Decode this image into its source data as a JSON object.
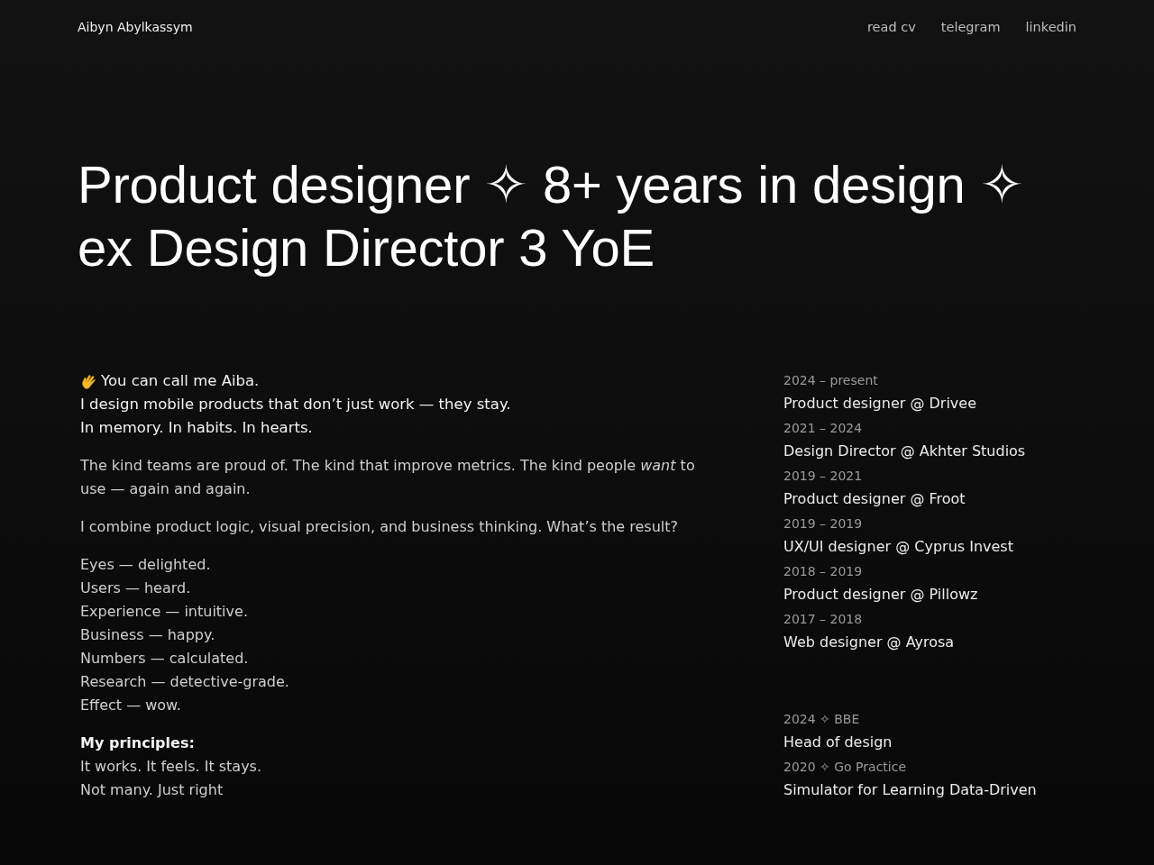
{
  "header": {
    "name": "Aibyn Abylkassym",
    "links": [
      "read cv",
      "telegram",
      "linkedin"
    ]
  },
  "headline": [
    "Product designer ✧ 8+ years in design ✧",
    "ex Design Director 3 YoE"
  ],
  "intro": [
    "You can call me Aiba.",
    "I design mobile products that don’t just work — they stay.",
    "In memory. In habits. In hearts."
  ],
  "paragraphs": [
    "The kind teams are proud of. The kind that improve metrics. The kind people *want* to use — again and again.",
    "I combine product logic, visual precision, and business thinking. What’s the result?"
  ],
  "results": [
    "Eyes — delighted.",
    "Users — heard.",
    "Experience — intuitive.",
    "Business — happy.",
    "Numbers — calculated.",
    "Research — detective-grade.",
    "Effect — wow."
  ],
  "principles": {
    "title": "My principles:",
    "lines": [
      "It works. It feels. It stays.",
      "Not many. Just right"
    ]
  },
  "experience": [
    {
      "period": "2024 – present",
      "role": "Product designer @ Drivee"
    },
    {
      "period": "2021 – 2024",
      "role": "Design Director @ Akhter Studios"
    },
    {
      "period": "2019 – 2021",
      "role": "Product designer @ Froot"
    },
    {
      "period": "2019 – 2019",
      "role": "UX/UI designer @ Cyprus Invest"
    },
    {
      "period": "2018 – 2019",
      "role": "Product designer @ Pillowz"
    },
    {
      "period": "2017 – 2018",
      "role": "Web designer @ Ayrosa"
    }
  ],
  "projects": [
    {
      "period": "2024 ✧ BBE",
      "role": "Head of design"
    },
    {
      "period": "2020 ✧ Go Practice",
      "role": "Simulator for Learning Data-Driven"
    }
  ]
}
